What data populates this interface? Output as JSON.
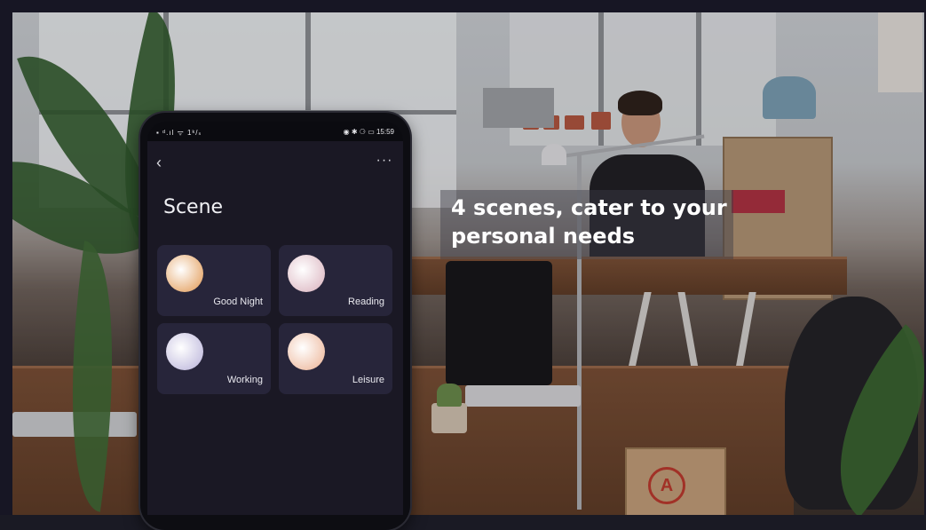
{
  "caption": {
    "line1": "4 scenes, cater to your",
    "line2": "personal needs"
  },
  "phone": {
    "status": {
      "left": "▪ ᵈ.ıl ᯤ 1ᵏ/ₛ",
      "right": "◉ ✱ ⚆ ▭ 15:59"
    },
    "toolbar": {
      "back_icon": "‹",
      "more_icon": "···"
    },
    "page_title": "Scene",
    "scenes": [
      {
        "label": "Good Night",
        "color": "#e8b07a"
      },
      {
        "label": "Reading",
        "color": "#e2c3cc"
      },
      {
        "label": "Working",
        "color": "#c9c4e2"
      },
      {
        "label": "Leisure",
        "color": "#f0c4ad"
      }
    ]
  }
}
